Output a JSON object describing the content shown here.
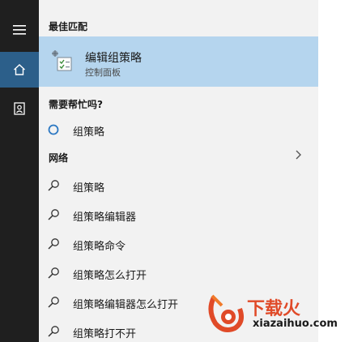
{
  "sidebar": {
    "items": [
      {
        "icon": "hamburger-menu-icon"
      },
      {
        "icon": "home-icon",
        "active": true
      },
      {
        "icon": "user-profile-icon"
      }
    ],
    "active_color": "#2c5f8a",
    "background": "#1f1f1f"
  },
  "results": {
    "best_match_header": "最佳匹配",
    "best_match": {
      "title": "编辑组策略",
      "subtitle": "控制面板",
      "icon": "group-policy-editor-icon",
      "highlight_color": "#b5d5ee"
    },
    "help_header": "需要帮忙吗?",
    "help_items": [
      {
        "label": "组策略",
        "icon": "cortana-circle-icon"
      }
    ],
    "web_header": "网络",
    "web_items": [
      {
        "label": "组策略",
        "icon": "search-icon"
      },
      {
        "label": "组策略编辑器",
        "icon": "search-icon"
      },
      {
        "label": "组策略命令",
        "icon": "search-icon"
      },
      {
        "label": "组策略怎么打开",
        "icon": "search-icon"
      },
      {
        "label": "组策略编辑器怎么打开",
        "icon": "search-icon"
      },
      {
        "label": "组策略打不开",
        "icon": "search-icon"
      }
    ]
  },
  "watermark": {
    "name": "下载火",
    "url": "xiazaihuo.com",
    "color": "#e04a28"
  }
}
